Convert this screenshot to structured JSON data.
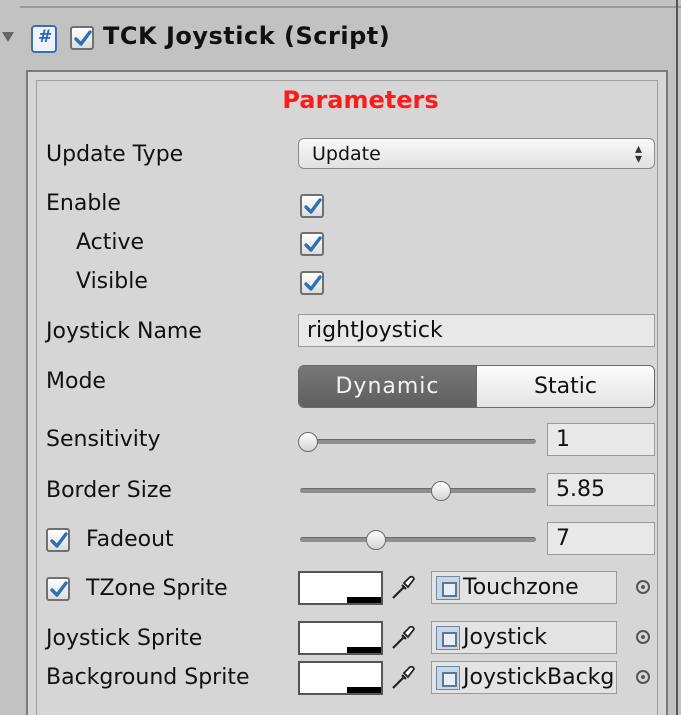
{
  "component": {
    "title": "TCK Joystick (Script)",
    "enabled": true,
    "icon": "script-icon"
  },
  "section": {
    "heading": "Parameters"
  },
  "update_type": {
    "label": "Update Type",
    "value": "Update"
  },
  "enable": {
    "label": "Enable",
    "checked": true
  },
  "active": {
    "label": "Active",
    "checked": true
  },
  "visible": {
    "label": "Visible",
    "checked": true
  },
  "joystick_name": {
    "label": "Joystick Name",
    "value": "rightJoystick"
  },
  "mode": {
    "label": "Mode",
    "options": [
      "Dynamic",
      "Static"
    ],
    "selected": "Dynamic"
  },
  "sensitivity": {
    "label": "Sensitivity",
    "value": "1"
  },
  "border_size": {
    "label": "Border Size",
    "value": "5.85"
  },
  "fadeout": {
    "label": "Fadeout",
    "checked": true,
    "value": "7"
  },
  "tzone_sprite": {
    "label": "TZone Sprite",
    "checked": true,
    "object": "Touchzone"
  },
  "joystick_sprite": {
    "label": "Joystick Sprite",
    "object": "Joystick"
  },
  "background_sprite": {
    "label": "Background Sprite",
    "object": "JoystickBackground"
  },
  "colors": {
    "heading": "#ff1a1a",
    "check": "#2f6fb3",
    "panel": "#d6d6d6",
    "active_segment": "#666666"
  }
}
